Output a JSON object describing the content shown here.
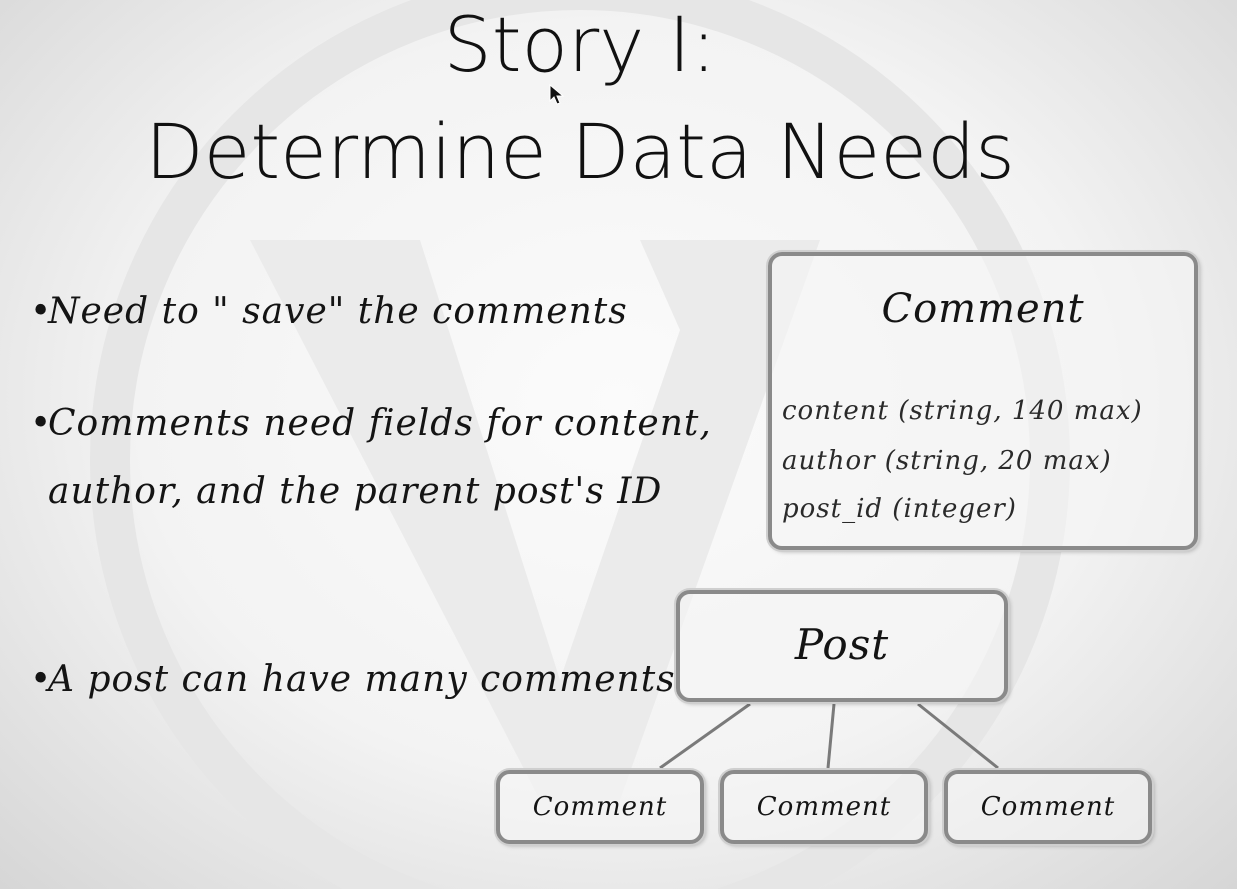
{
  "title": {
    "line1": "Story I:",
    "line2": "Determine Data Needs"
  },
  "bullets": [
    {
      "marker": "•",
      "text": "Need to \" save\" the comments"
    },
    {
      "marker": "•",
      "text": "Comments need fields for content, author, and the parent post's ID"
    },
    {
      "marker": "•",
      "text": "A post can have many comments"
    }
  ],
  "comment_schema": {
    "heading": "Comment",
    "fields": [
      "content (string, 140 max)",
      "author (string, 20 max)",
      "post_id (integer)"
    ]
  },
  "relationship": {
    "parent": "Post",
    "children": [
      "Comment",
      "Comment",
      "Comment"
    ]
  },
  "icons": {
    "watermark": "wordpress-logo-icon",
    "cursor": "mouse-pointer-icon"
  },
  "colors": {
    "background": "#f1f1f1",
    "box_border": "#8a8a8a",
    "text": "#111111"
  }
}
